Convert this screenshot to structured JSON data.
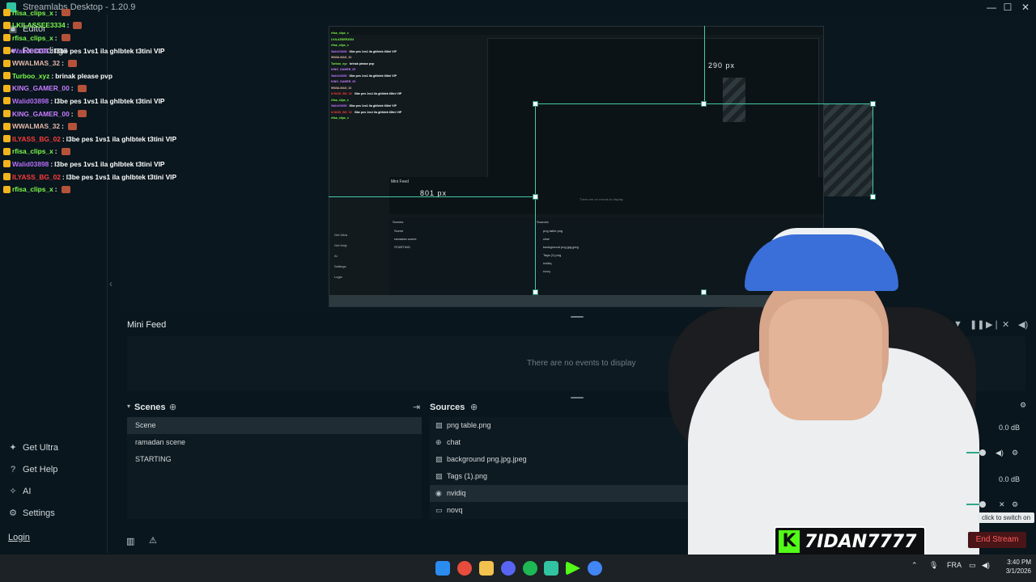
{
  "window": {
    "title": "Streamlabs Desktop - 1.20.9",
    "minimize": "—",
    "maximize": "☐",
    "close": "✕"
  },
  "leftnav": {
    "editor": "Editor",
    "recordings": "Recordings",
    "bottom_items": [
      {
        "label": "Get Ultra",
        "icon": "ultra-icon"
      },
      {
        "label": "Get Help",
        "icon": "help-icon"
      },
      {
        "label": "AI",
        "icon": "ai-icon"
      },
      {
        "label": "Settings",
        "icon": "gear-icon"
      }
    ],
    "login": "Login"
  },
  "chat": [
    {
      "user": "rfisa_clips_x",
      "color": "#7dfc4c",
      "msg": ""
    },
    {
      "user": "LKILASSEE3334",
      "color": "#7dfc4c",
      "msg": ""
    },
    {
      "user": "rfisa_clips_x",
      "color": "#7dfc4c",
      "msg": ""
    },
    {
      "user": "Walid03898",
      "color": "#b56ef5",
      "msg": "l3be pes 1vs1 ila ghlbtek t3tini VIP"
    },
    {
      "user": "WWALMAS_32",
      "color": "#e3b7a8",
      "msg": ""
    },
    {
      "user": "Turboo_xyz",
      "color": "#7dfc4c",
      "msg": "brinak please pvp"
    },
    {
      "user": "KING_GAMER_00",
      "color": "#c77dff",
      "msg": ""
    },
    {
      "user": "Walid03898",
      "color": "#b56ef5",
      "msg": "l3be pes 1vs1 ila ghlbtek t3tini VIP"
    },
    {
      "user": "KING_GAMER_00",
      "color": "#c77dff",
      "msg": ""
    },
    {
      "user": "WWALMAS_32",
      "color": "#e3b7a8",
      "msg": ""
    },
    {
      "user": "ILYASS_BG_02",
      "color": "#ff3b3b",
      "msg": "l3be pes 1vs1 ila ghlbtek t3tini VIP"
    },
    {
      "user": "rfisa_clips_x",
      "color": "#7dfc4c",
      "msg": ""
    },
    {
      "user": "Walid03898",
      "color": "#b56ef5",
      "msg": "l3be pes 1vs1 ila ghlbtek t3tini VIP"
    },
    {
      "user": "ILYASS_BG_02",
      "color": "#ff3b3b",
      "msg": "l3be pes 1vs1 ila ghlbtek t3tini VIP"
    },
    {
      "user": "rfisa_clips_x",
      "color": "#7dfc4c",
      "msg": ""
    }
  ],
  "preview": {
    "width_label": "801 px",
    "height_label": "290 px",
    "mini_feed_label": "Mini Feed",
    "mini_empty": "There are no events to display",
    "mini_left": [
      "Get Ultra",
      "Get Help",
      "AI",
      "Settings",
      "Login"
    ],
    "mini_scenes_header": "Scenes",
    "mini_scenes": [
      "Scene",
      "ramadan scene",
      "STARTING"
    ],
    "mini_sources_header": "Sources",
    "mini_sources": [
      "png table.png",
      "chat",
      "background png.jpg.jpeg",
      "Tags (1).png",
      "nvidiq",
      "novq"
    ],
    "cam_logo": "7IDAN7"
  },
  "minifeed": {
    "label": "Mini Feed",
    "empty": "There are no events to display"
  },
  "scenes": {
    "header": "Scenes",
    "items": [
      "Scene",
      "ramadan scene",
      "STARTING"
    ],
    "active_index": 0
  },
  "sources": {
    "header": "Sources",
    "items": [
      {
        "label": "png table.png",
        "icon": "image-icon"
      },
      {
        "label": "chat",
        "icon": "globe-icon"
      },
      {
        "label": "background png.jpg.jpeg",
        "icon": "image-icon"
      },
      {
        "label": "Tags (1).png",
        "icon": "image-icon"
      },
      {
        "label": "nvidiq",
        "icon": "webcam-icon"
      },
      {
        "label": "novq",
        "icon": "monitor-icon"
      }
    ],
    "active_index": 4
  },
  "mixer": {
    "levels": [
      "0.0 dB",
      "0.0 dB"
    ],
    "tooltip": "click to switch on"
  },
  "footer": {
    "end_stream": "End Stream"
  },
  "overlay": {
    "logo_k": "K",
    "logo_text": "7IDAN7777"
  },
  "taskbar": {
    "language": "FRA",
    "time": "3:40 PM",
    "date": "3/1/2026"
  }
}
